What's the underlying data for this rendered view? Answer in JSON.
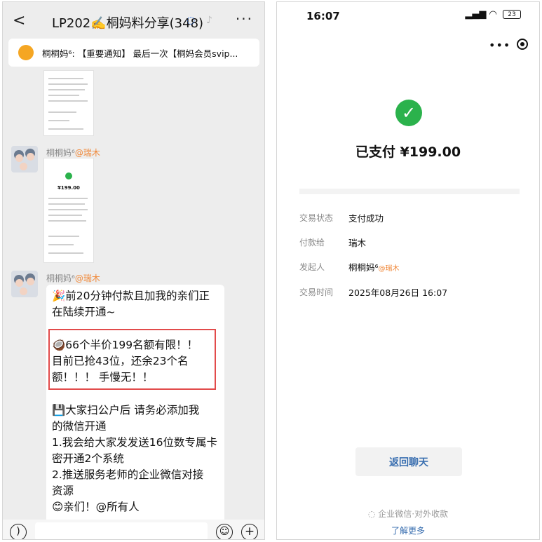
{
  "left": {
    "title": "LP202✍️桐妈料分享(348)",
    "notice": "桐桐妈⁶: 【重要通知】 最后一次【桐妈会员svip...",
    "messages": [
      {
        "sender": "桐桐妈⁶",
        "mention": "@瑞木",
        "type": "image"
      },
      {
        "sender": "桐桐妈⁶",
        "mention": "@瑞木",
        "type": "text"
      }
    ],
    "screenshot_amount": "¥199.00",
    "bubble_lines": [
      "🎉前20分钟付款且加我的亲们正",
      "在陆续开通~",
      "",
      "🥥66个半价199名额有限！！",
      "目前已抢43位，还余23个名",
      "额！！！ 手慢无！！",
      "",
      "💾大家扫公户后  请务必添加我",
      "的微信开通",
      "1.我会给大家发发送16位数专属卡",
      "密开通2个系统",
      "2.推送服务老师的企业微信对接",
      "资源",
      "😊亲们！@所有人"
    ]
  },
  "right": {
    "status_time": "16:07",
    "battery": "23",
    "paid_text": "已支付 ¥199.00",
    "details": [
      {
        "label": "交易状态",
        "value": "支付成功"
      },
      {
        "label": "付款给",
        "value": "瑞木"
      },
      {
        "label": "发起人",
        "value": "桐桐妈⁶",
        "mention": "@瑞木"
      },
      {
        "label": "交易时间",
        "value": "2025年08月26日 16:07"
      }
    ],
    "return_button": "返回聊天",
    "footer": "企业微信·对外收款",
    "learn_more": "了解更多"
  }
}
